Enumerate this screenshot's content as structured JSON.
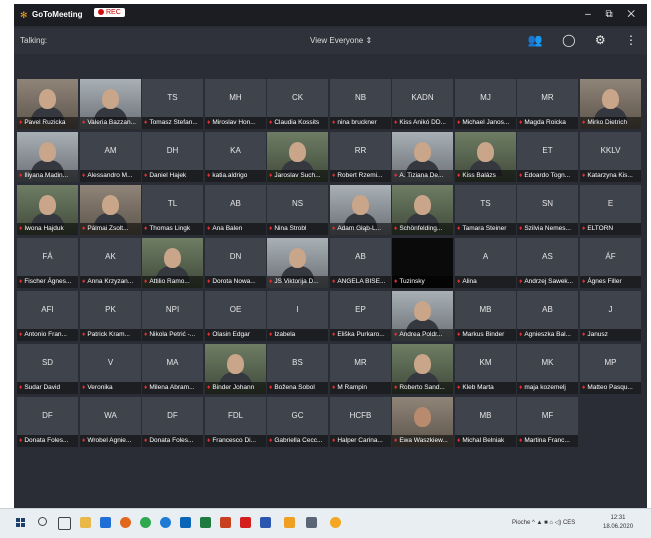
{
  "window": {
    "app_name": "GoToMeeting",
    "rec_label": "REC",
    "controls": "– ⧉ ✕",
    "logo_icon": "gotomeeting-logo-icon"
  },
  "toolbar": {
    "talking_label": "Talking:",
    "view_label": "View Everyone",
    "view_icon": "updown-chevron-icon",
    "people_icon": "people-icon",
    "chat_icon": "chat-icon",
    "settings_icon": "gear-icon",
    "more_icon": "more-vertical-icon"
  },
  "participants": [
    {
      "name": "Pavel Ruzicka",
      "initials": "",
      "video": true
    },
    {
      "name": "Valeria Bazzan...",
      "initials": "",
      "video": true
    },
    {
      "name": "Tomasz Stefan...",
      "initials": "TS",
      "video": false
    },
    {
      "name": "Miroslav Hon...",
      "initials": "MH",
      "video": false
    },
    {
      "name": "Claudia Kossits",
      "initials": "CK",
      "video": false
    },
    {
      "name": "nina bruckner",
      "initials": "NB",
      "video": false
    },
    {
      "name": "Kiss Anikó DD...",
      "initials": "KADN",
      "video": false
    },
    {
      "name": "Michael Janos...",
      "initials": "MJ",
      "video": false
    },
    {
      "name": "Magda Roicka",
      "initials": "MR",
      "video": false
    },
    {
      "name": "Mirko Dietrich",
      "initials": "",
      "video": true
    },
    {
      "name": "Iliyana Madin...",
      "initials": "",
      "video": true
    },
    {
      "name": "Alessandro M...",
      "initials": "AM",
      "video": false
    },
    {
      "name": "Daniel Hajek",
      "initials": "DH",
      "video": false
    },
    {
      "name": "katia.aldrigo",
      "initials": "KA",
      "video": false
    },
    {
      "name": "Jaroslav Such...",
      "initials": "",
      "video": true
    },
    {
      "name": "Robert Rzemi...",
      "initials": "RR",
      "video": false
    },
    {
      "name": "A. Tiziana De...",
      "initials": "",
      "video": true
    },
    {
      "name": "Kiss Balázs",
      "initials": "",
      "video": true
    },
    {
      "name": "Edoardo Togn...",
      "initials": "ET",
      "video": false
    },
    {
      "name": "Katarzyna Kis...",
      "initials": "KKLV",
      "video": false
    },
    {
      "name": "Iwona Hajduk",
      "initials": "",
      "video": true
    },
    {
      "name": "Pálmai Zsolt...",
      "initials": "",
      "video": true
    },
    {
      "name": "Thomas Lingk",
      "initials": "TL",
      "video": false
    },
    {
      "name": "Ana Balen",
      "initials": "AB",
      "video": false
    },
    {
      "name": "Nina Strobl",
      "initials": "NS",
      "video": false
    },
    {
      "name": "Adam Głąb-L...",
      "initials": "",
      "video": true
    },
    {
      "name": "Schönfelding...",
      "initials": "",
      "video": true
    },
    {
      "name": "Tamara Steiner",
      "initials": "TS",
      "video": false
    },
    {
      "name": "Szilvia Nemes...",
      "initials": "SN",
      "video": false
    },
    {
      "name": "ELTORN",
      "initials": "E",
      "video": false
    },
    {
      "name": "Fischer Ágnes...",
      "initials": "FÁ",
      "video": false
    },
    {
      "name": "Anna Krzyzan...",
      "initials": "AK",
      "video": false
    },
    {
      "name": "Attilio Ramo...",
      "initials": "",
      "video": true
    },
    {
      "name": "Dorota Nowa...",
      "initials": "DN",
      "video": false
    },
    {
      "name": "JS Viktorija D...",
      "initials": "",
      "video": true
    },
    {
      "name": "ANGELA BISE...",
      "initials": "AB",
      "video": false
    },
    {
      "name": "Tuzinsky",
      "initials": "",
      "video": false,
      "dark": true
    },
    {
      "name": "Alina",
      "initials": "A",
      "video": false
    },
    {
      "name": "Andrzej Sawek...",
      "initials": "AS",
      "video": false
    },
    {
      "name": "Ágnes Filler",
      "initials": "ÁF",
      "video": false
    },
    {
      "name": "Antonio Fran...",
      "initials": "AFI",
      "video": false
    },
    {
      "name": "Patrick Kram...",
      "initials": "PK",
      "video": false
    },
    {
      "name": "Nikola Petrić -...",
      "initials": "NPI",
      "video": false
    },
    {
      "name": "Olasin Edgar",
      "initials": "OE",
      "video": false
    },
    {
      "name": "Izabela",
      "initials": "I",
      "video": false
    },
    {
      "name": "Eliška Purkaro...",
      "initials": "EP",
      "video": false
    },
    {
      "name": "Andrea Poldr...",
      "initials": "",
      "video": true
    },
    {
      "name": "Markus Binder",
      "initials": "MB",
      "video": false
    },
    {
      "name": "Agnieszka Bal...",
      "initials": "AB",
      "video": false
    },
    {
      "name": "Janusz",
      "initials": "J",
      "video": false
    },
    {
      "name": "Sudar David",
      "initials": "SD",
      "video": false
    },
    {
      "name": "Veronika",
      "initials": "V",
      "video": false
    },
    {
      "name": "Milena Abram...",
      "initials": "MA",
      "video": false
    },
    {
      "name": "Binder Johann",
      "initials": "",
      "video": true
    },
    {
      "name": "Božena Sobol",
      "initials": "BS",
      "video": false
    },
    {
      "name": "M Rampin",
      "initials": "MR",
      "video": false
    },
    {
      "name": "Roberto Sand...",
      "initials": "",
      "video": true
    },
    {
      "name": "Kleb Marta",
      "initials": "KM",
      "video": false
    },
    {
      "name": "maja kozemelj",
      "initials": "MK",
      "video": false
    },
    {
      "name": "Matteo Pasqu...",
      "initials": "MP",
      "video": false
    },
    {
      "name": "Donata Foles...",
      "initials": "DF",
      "video": false
    },
    {
      "name": "Wrobel Agnie...",
      "initials": "WA",
      "video": false
    },
    {
      "name": "Donata Foles...",
      "initials": "DF",
      "video": false
    },
    {
      "name": "Francesco Di...",
      "initials": "FDL",
      "video": false
    },
    {
      "name": "Gabriella Cecc...",
      "initials": "GC",
      "video": false
    },
    {
      "name": "Halper Carina...",
      "initials": "HCFB",
      "video": false
    },
    {
      "name": "Ewa Waszkiew...",
      "initials": "",
      "video": true,
      "dark": true
    },
    {
      "name": "Michal Belniak",
      "initials": "MB",
      "video": false
    },
    {
      "name": "Martina Franc...",
      "initials": "MF",
      "video": false
    }
  ],
  "taskbar": {
    "tray_text": "Pioche ^ ▲ ■ ⌂ ◁) CES",
    "time": "12:31",
    "date": "18.06.2020"
  }
}
